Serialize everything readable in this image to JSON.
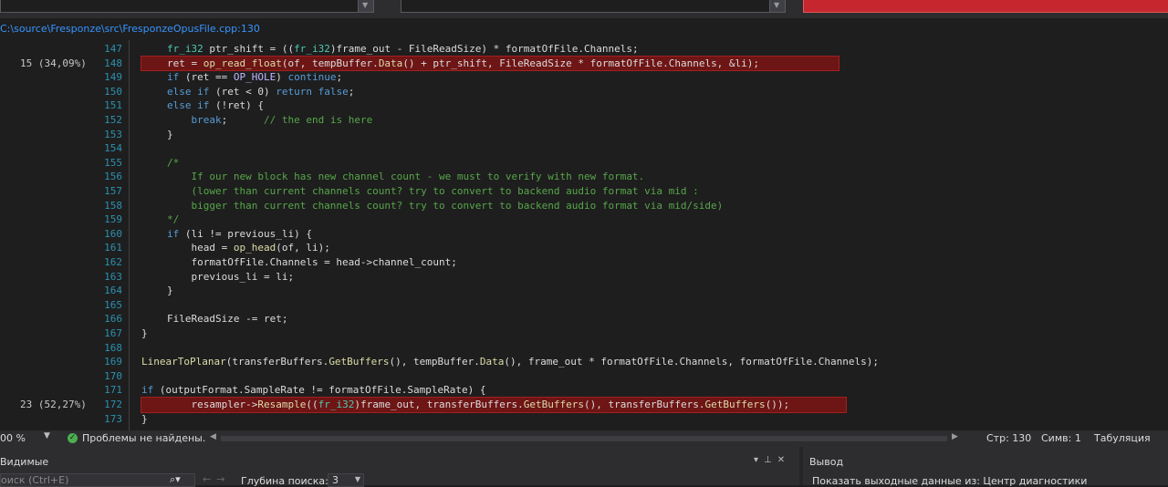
{
  "file_path": "C:\\source\\Fresponze\\src\\FresponzeOpusFile.cpp:130",
  "lines": [
    {
      "num": "147",
      "hits": "",
      "hot": false,
      "code": "fr_i32 ptr_shift = ((fr_i32)frame_out - FileReadSize) * formatOfFile.Channels;"
    },
    {
      "num": "148",
      "hits": "15 (34,09%)",
      "hot": true,
      "code": "ret = op_read_float(of, tempBuffer.Data() + ptr_shift, FileReadSize * formatOfFile.Channels, &li);"
    },
    {
      "num": "149",
      "hits": "",
      "hot": false,
      "code": "if (ret == OP_HOLE) continue;"
    },
    {
      "num": "150",
      "hits": "",
      "hot": false,
      "code": "else if (ret < 0) return false;"
    },
    {
      "num": "151",
      "hits": "",
      "hot": false,
      "code": "else if (!ret) {"
    },
    {
      "num": "152",
      "hits": "",
      "hot": false,
      "code": "    break;      // the end is here"
    },
    {
      "num": "153",
      "hits": "",
      "hot": false,
      "code": "}"
    },
    {
      "num": "154",
      "hits": "",
      "hot": false,
      "code": ""
    },
    {
      "num": "155",
      "hits": "",
      "hot": false,
      "code": "/*"
    },
    {
      "num": "156",
      "hits": "",
      "hot": false,
      "code": "    If our new block has new channel count - we must to verify with new format."
    },
    {
      "num": "157",
      "hits": "",
      "hot": false,
      "code": "    (lower than current channels count? try to convert to backend audio format via mid :"
    },
    {
      "num": "158",
      "hits": "",
      "hot": false,
      "code": "    bigger than current channels count? try to convert to backend audio format via mid/side)"
    },
    {
      "num": "159",
      "hits": "",
      "hot": false,
      "code": "*/"
    },
    {
      "num": "160",
      "hits": "",
      "hot": false,
      "code": "if (li != previous_li) {"
    },
    {
      "num": "161",
      "hits": "",
      "hot": false,
      "code": "    head = op_head(of, li);"
    },
    {
      "num": "162",
      "hits": "",
      "hot": false,
      "code": "    formatOfFile.Channels = head->channel_count;"
    },
    {
      "num": "163",
      "hits": "",
      "hot": false,
      "code": "    previous_li = li;"
    },
    {
      "num": "164",
      "hits": "",
      "hot": false,
      "code": "}"
    },
    {
      "num": "165",
      "hits": "",
      "hot": false,
      "code": ""
    },
    {
      "num": "166",
      "hits": "",
      "hot": false,
      "code": "FileReadSize -= ret;"
    },
    {
      "num": "167",
      "hits": "",
      "hot": false,
      "code": "}"
    },
    {
      "num": "168",
      "hits": "",
      "hot": false,
      "code": ""
    },
    {
      "num": "169",
      "hits": "",
      "hot": false,
      "code": "LinearToPlanar(transferBuffers.GetBuffers(), tempBuffer.Data(), frame_out * formatOfFile.Channels, formatOfFile.Channels);"
    },
    {
      "num": "170",
      "hits": "",
      "hot": false,
      "code": ""
    },
    {
      "num": "171",
      "hits": "",
      "hot": false,
      "code": "if (outputFormat.SampleRate != formatOfFile.SampleRate) {"
    },
    {
      "num": "172",
      "hits": "23 (52,27%)",
      "hot": true,
      "code": "    resampler->Resample((fr_i32)frame_out, transferBuffers.GetBuffers(), transferBuffers.GetBuffers());"
    },
    {
      "num": "173",
      "hits": "",
      "hot": false,
      "code": "}"
    }
  ],
  "status": {
    "zoom": "00 %",
    "problems": "Проблемы не найдены.",
    "line": "Стр: 130",
    "col": "Симв: 1",
    "tab": "Табуляция"
  },
  "bottom": {
    "left_title": "Видимые",
    "search_placeholder": "оиск (Ctrl+E)",
    "depth_label": "Глубина поиска:",
    "depth_value": "3",
    "right_title": "Вывод",
    "output_from": "Показать выходные данные из:   Центр диагностики"
  },
  "colors": {
    "keyword": "#569cd6",
    "function": "#dcdcaa",
    "type": "#4ec9b0",
    "comment": "#57a64a",
    "macro": "#beb7ff",
    "hot_bg": "#6e1515"
  }
}
